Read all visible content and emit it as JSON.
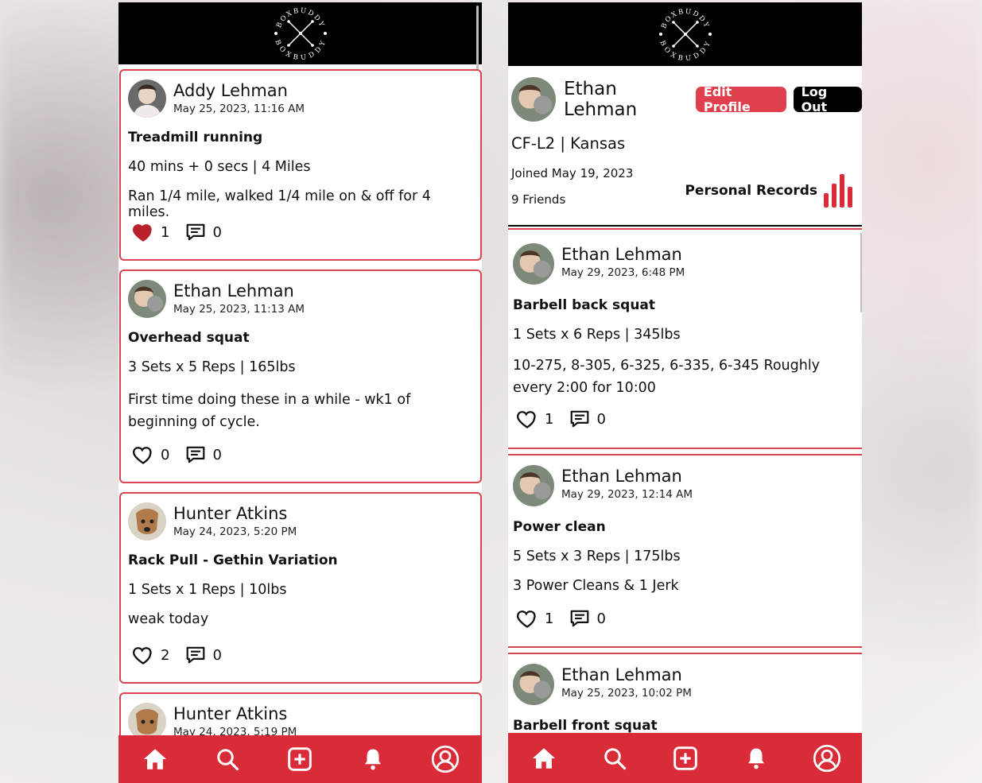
{
  "brand": {
    "logo_text_top": "BOXBUDDY",
    "logo_text_bottom": "BOXBUDDY",
    "accent": "#d92b38"
  },
  "feed": {
    "posts": [
      {
        "author": "Addy Lehman",
        "date": "May 25, 2023, 11:16 AM",
        "title": "Treadmill running",
        "metric": "40 mins + 0 secs | 4 Miles",
        "note": "Ran 1/4 mile, walked 1/4 mile on & off for 4 miles.",
        "likes": "1",
        "comments": "0",
        "liked": true
      },
      {
        "author": "Ethan Lehman",
        "date": "May 25, 2023, 11:13 AM",
        "title": "Overhead squat",
        "metric": "3 Sets x 5 Reps | 165lbs",
        "note": "First time doing these in a while - wk1 of beginning of cycle.",
        "likes": "0",
        "comments": "0",
        "liked": false
      },
      {
        "author": "Hunter Atkins",
        "date": "May 24, 2023, 5:20 PM",
        "title": "Rack Pull - Gethin Variation",
        "metric": "1 Sets x 1 Reps | 10lbs",
        "note": "weak today",
        "likes": "2",
        "comments": "0",
        "liked": false
      },
      {
        "author": "Hunter Atkins",
        "date": "May 24, 2023, 5:19 PM"
      }
    ]
  },
  "profile": {
    "name": "Ethan Lehman",
    "edit_label": "Edit Profile",
    "logout_label": "Log Out",
    "subtitle": "CF-L2 | Kansas",
    "joined": "Joined May 19, 2023",
    "friends": "9 Friends",
    "records_label": "Personal Records",
    "posts": [
      {
        "author": "Ethan Lehman",
        "date": "May 29, 2023, 6:48 PM",
        "title": "Barbell back squat",
        "metric": "1 Sets x 6 Reps | 345lbs",
        "note": "10-275, 8-305, 6-325, 6-335, 6-345 Roughly every 2:00 for 10:00",
        "likes": "1",
        "comments": "0"
      },
      {
        "author": "Ethan Lehman",
        "date": "May 29, 2023, 12:14 AM",
        "title": "Power clean",
        "metric": "5 Sets x 3 Reps | 175lbs",
        "note": "3 Power Cleans & 1 Jerk",
        "likes": "1",
        "comments": "0"
      },
      {
        "author": "Ethan Lehman",
        "date": "May 25, 2023, 10:02 PM",
        "title": "Barbell front squat"
      }
    ]
  },
  "nav": {
    "tabs": [
      "home-icon",
      "search-icon",
      "add-post-icon",
      "notifications-icon",
      "profile-icon"
    ]
  }
}
